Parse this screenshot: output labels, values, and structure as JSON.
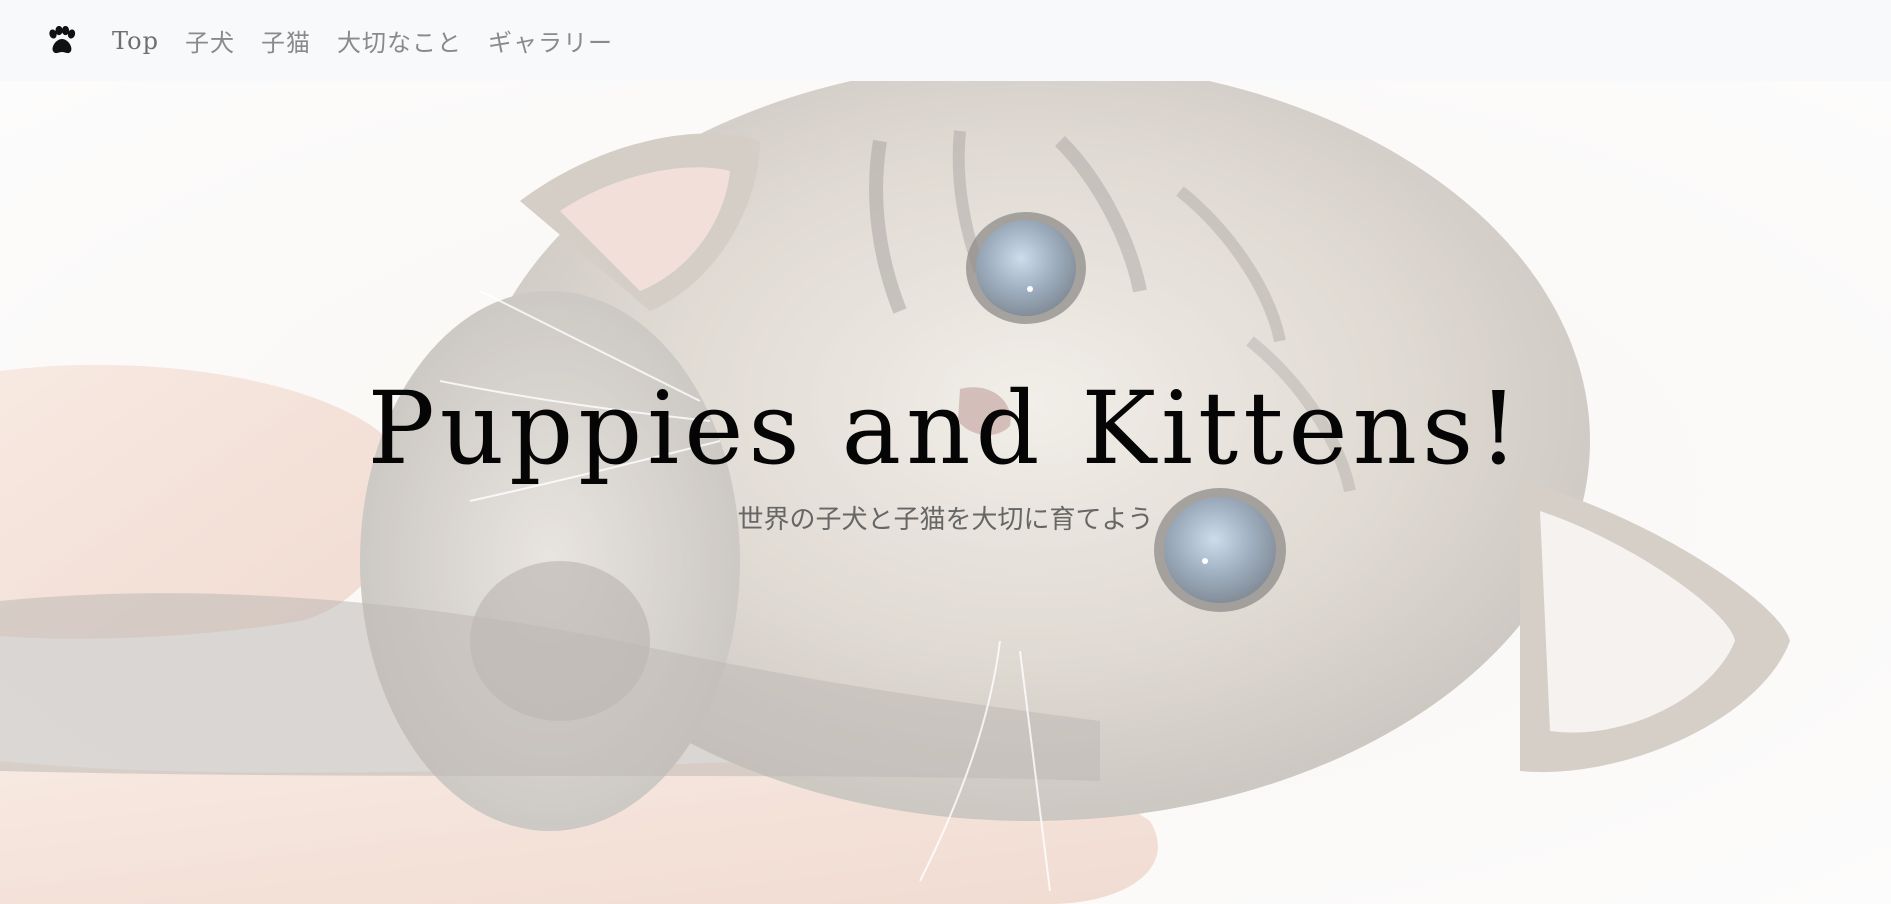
{
  "nav": {
    "brand_icon": "paw-icon",
    "items": [
      {
        "label": "Top",
        "active": true
      },
      {
        "label": "子犬",
        "active": false
      },
      {
        "label": "子猫",
        "active": false
      },
      {
        "label": "大切なこと",
        "active": false
      },
      {
        "label": "ギャラリー",
        "active": false
      }
    ]
  },
  "hero": {
    "title": "Puppies and Kittens!",
    "subtitle": "世界の子犬と子猫を大切に育てよう",
    "background_image": "kitten-photo"
  },
  "colors": {
    "navbar_bg": "#f8f9fa",
    "nav_text": "#8a8a8a",
    "title_text": "#050505",
    "subtitle_text": "#666666"
  }
}
